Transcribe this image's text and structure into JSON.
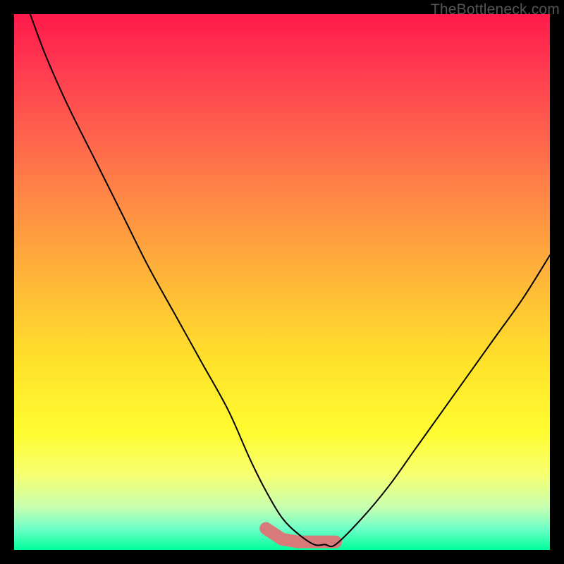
{
  "watermark": "TheBottleneck.com",
  "chart_data": {
    "type": "line",
    "title": "",
    "xlabel": "",
    "ylabel": "",
    "xlim": [
      0,
      100
    ],
    "ylim": [
      0,
      100
    ],
    "series": [
      {
        "name": "curve",
        "x": [
          3,
          6,
          10,
          15,
          20,
          25,
          30,
          35,
          40,
          44,
          47,
          50,
          53,
          56,
          58,
          60,
          65,
          70,
          75,
          80,
          85,
          90,
          95,
          100
        ],
        "values": [
          100,
          92,
          83,
          73,
          63,
          53,
          44,
          35,
          26,
          17,
          11,
          6,
          3,
          1,
          1,
          1,
          6,
          12,
          19,
          26,
          33,
          40,
          47,
          55
        ]
      },
      {
        "name": "highlight-band",
        "x": [
          47,
          50,
          53,
          56,
          58,
          60
        ],
        "values": [
          4,
          2,
          1.5,
          1.5,
          1.5,
          1.5
        ]
      }
    ],
    "colors": {
      "curve": "#000000",
      "highlight": "#d97a7a",
      "gradient_top": "#ff1a4a",
      "gradient_bottom": "#00ff9c"
    }
  }
}
